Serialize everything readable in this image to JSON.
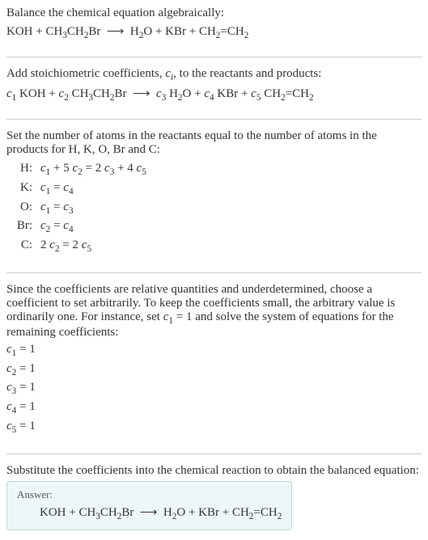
{
  "section1": {
    "title": "Balance the chemical equation algebraically:",
    "equation_html": "KOH + CH<sub>3</sub>CH<sub>2</sub>Br &nbsp;⟶&nbsp; H<sub>2</sub>O + KBr + CH<sub>2</sub>=CH<sub>2</sub>"
  },
  "section2": {
    "title_html": "Add stoichiometric coefficients, <span class=\"italic\">c<sub>i</sub></span>, to the reactants and products:",
    "equation_html": "<span class=\"italic\">c</span><sub>1</sub> KOH + <span class=\"italic\">c</span><sub>2</sub> CH<sub>3</sub>CH<sub>2</sub>Br &nbsp;⟶&nbsp; <span class=\"italic\">c</span><sub>3</sub> H<sub>2</sub>O + <span class=\"italic\">c</span><sub>4</sub> KBr + <span class=\"italic\">c</span><sub>5</sub> CH<sub>2</sub>=CH<sub>2</sub>"
  },
  "section3": {
    "title": "Set the number of atoms in the reactants equal to the number of atoms in the products for H, K, O, Br and C:",
    "rows": [
      {
        "label": "H:",
        "eq_html": "<span class=\"italic\">c</span><sub>1</sub> + 5 <span class=\"italic\">c</span><sub>2</sub> = 2 <span class=\"italic\">c</span><sub>3</sub> + 4 <span class=\"italic\">c</span><sub>5</sub>"
      },
      {
        "label": "K:",
        "eq_html": "<span class=\"italic\">c</span><sub>1</sub> = <span class=\"italic\">c</span><sub>4</sub>"
      },
      {
        "label": "O:",
        "eq_html": "<span class=\"italic\">c</span><sub>1</sub> = <span class=\"italic\">c</span><sub>3</sub>"
      },
      {
        "label": "Br:",
        "eq_html": "<span class=\"italic\">c</span><sub>2</sub> = <span class=\"italic\">c</span><sub>4</sub>"
      },
      {
        "label": "C:",
        "eq_html": "2 <span class=\"italic\">c</span><sub>2</sub> = 2 <span class=\"italic\">c</span><sub>5</sub>"
      }
    ]
  },
  "section4": {
    "title_html": "Since the coefficients are relative quantities and underdetermined, choose a coefficient to set arbitrarily. To keep the coefficients small, the arbitrary value is ordinarily one. For instance, set <span class=\"italic\">c</span><sub>1</sub> = 1 and solve the system of equations for the remaining coefficients:",
    "coeffs_html": [
      "<span class=\"italic\">c</span><sub>1</sub> = 1",
      "<span class=\"italic\">c</span><sub>2</sub> = 1",
      "<span class=\"italic\">c</span><sub>3</sub> = 1",
      "<span class=\"italic\">c</span><sub>4</sub> = 1",
      "<span class=\"italic\">c</span><sub>5</sub> = 1"
    ]
  },
  "section5": {
    "title": "Substitute the coefficients into the chemical reaction to obtain the balanced equation:",
    "answer_label": "Answer:",
    "answer_html": "KOH + CH<sub>3</sub>CH<sub>2</sub>Br &nbsp;⟶&nbsp; H<sub>2</sub>O + KBr + CH<sub>2</sub>=CH<sub>2</sub>"
  }
}
